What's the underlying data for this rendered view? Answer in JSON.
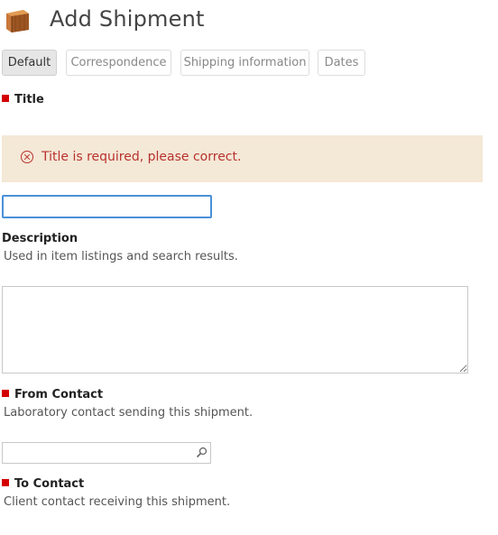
{
  "page": {
    "title": "Add Shipment",
    "icon": "box-icon"
  },
  "tabs": [
    {
      "label": "Default",
      "active": true
    },
    {
      "label": "Correspondence",
      "active": false
    },
    {
      "label": "Shipping information",
      "active": false
    },
    {
      "label": "Dates",
      "active": false
    }
  ],
  "fields": {
    "title": {
      "label": "Title",
      "required": true,
      "value": ""
    },
    "error": {
      "message": "Title is required, please correct.",
      "icon": "error-circle-icon"
    },
    "description": {
      "label": "Description",
      "help": "Used in item listings and search results.",
      "value": ""
    },
    "from_contact": {
      "label": "From Contact",
      "required": true,
      "help": "Laboratory contact sending this shipment.",
      "value": "",
      "icon": "search-icon"
    },
    "to_contact": {
      "label": "To Contact",
      "required": true,
      "help": "Client contact receiving this shipment."
    }
  },
  "colors": {
    "required_marker": "#d40000",
    "error_bg": "#f4e8d6",
    "error_text": "#b8312f",
    "focus_border": "#4a90d9"
  }
}
